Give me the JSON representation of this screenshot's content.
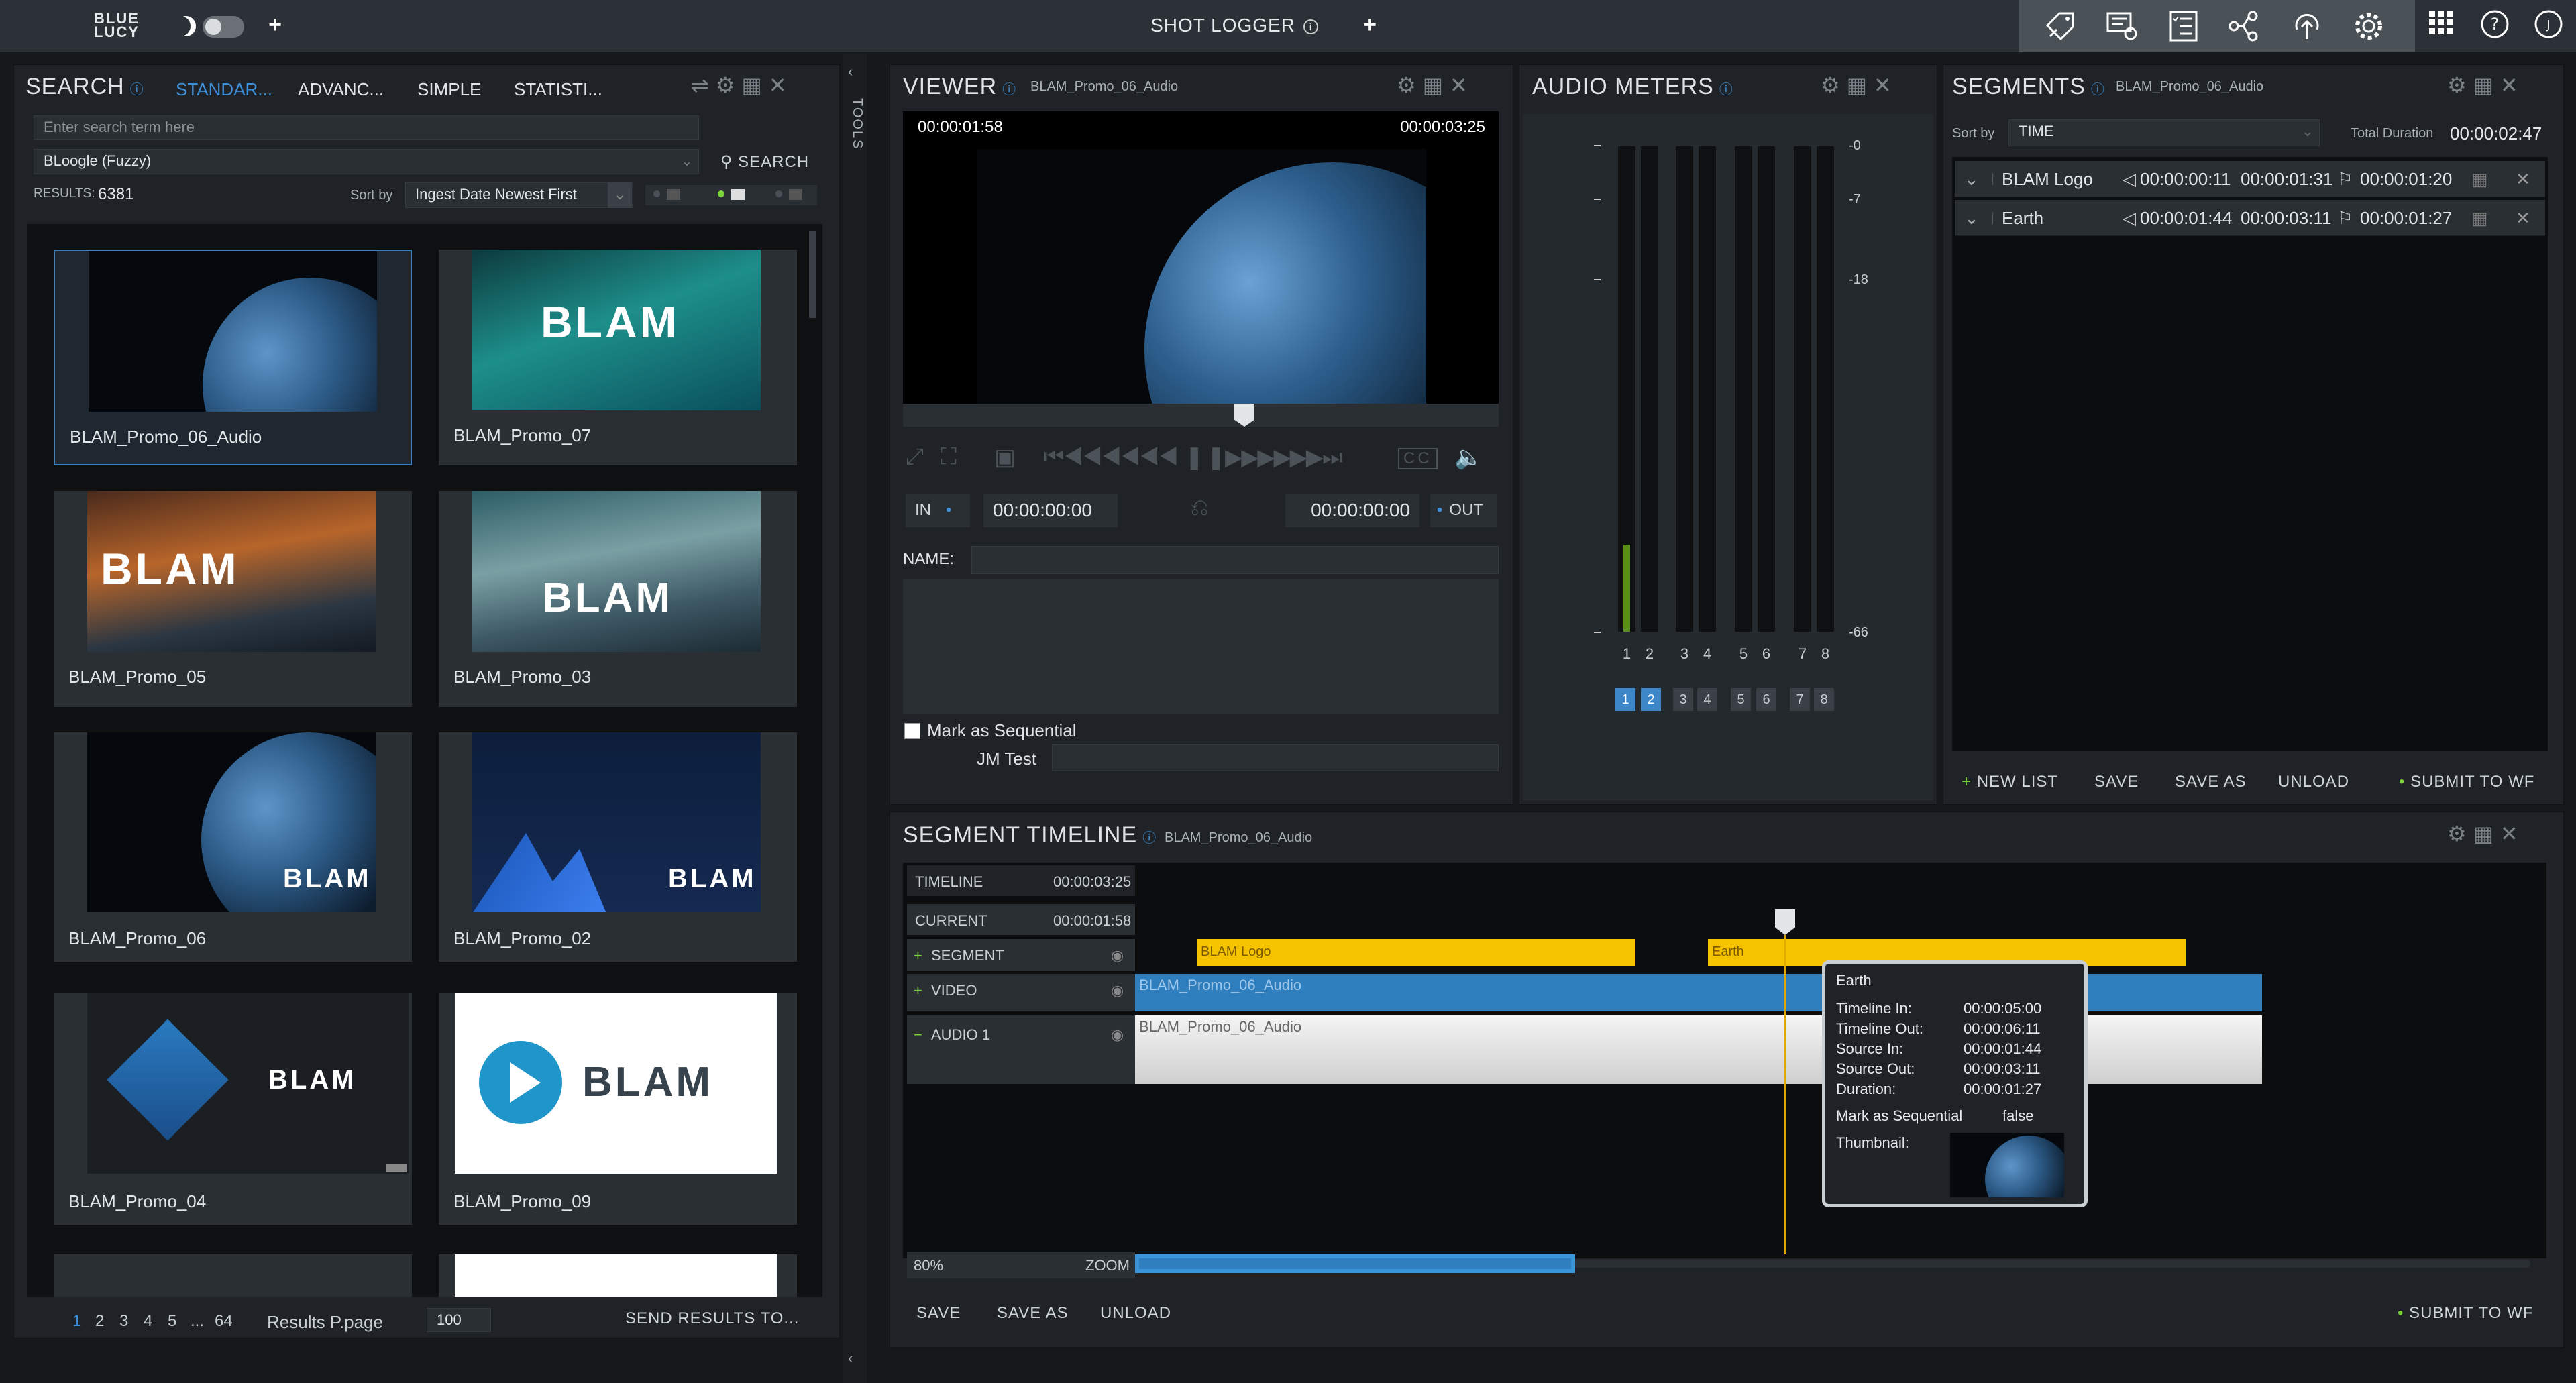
{
  "app": {
    "logo_line1": "BLUE",
    "logo_line2": "LUCY",
    "center_title": "SHOT LOGGER",
    "info_glyph": "i",
    "plus_glyph": "+"
  },
  "tools_icons": [
    "tag-edit-icon",
    "monitor-settings-icon",
    "checklist-icon",
    "workflow-icon",
    "upload-icon",
    "gear-icon",
    "grid-icon",
    "help-icon",
    "user-avatar-icon"
  ],
  "search": {
    "title": "SEARCH",
    "tabs": [
      "STANDAR...",
      "ADVANC...",
      "SIMPLE",
      "STATISTI..."
    ],
    "placeholder": "Enter search term here",
    "engine": "BLoogle (Fuzzy)",
    "search_button": "SEARCH",
    "results_label": "RESULTS:",
    "results_count": "6381",
    "sort_label": "Sort by",
    "sort_value": "Ingest Date Newest First",
    "items": [
      "BLAM_Promo_06_Audio",
      "BLAM_Promo_07",
      "BLAM_Promo_05",
      "BLAM_Promo_03",
      "BLAM_Promo_06",
      "BLAM_Promo_02",
      "BLAM_Promo_04",
      "BLAM_Promo_09"
    ],
    "blam_text": "BLAM",
    "pages": [
      "1",
      "2",
      "3",
      "4",
      "5",
      "...",
      "64"
    ],
    "results_per_page_label": "Results P.page",
    "results_per_page": "100",
    "send_results": "SEND RESULTS TO..."
  },
  "tools_tab": "TOOLS",
  "viewer": {
    "title": "VIEWER",
    "asset": "BLAM_Promo_06_Audio",
    "time_current": "00:00:01:58",
    "time_total": "00:00:03:25",
    "in_label": "IN",
    "out_label": "OUT",
    "in_time": "00:00:00:00",
    "out_time": "00:00:00:00",
    "name_label": "NAME:",
    "name_value": "",
    "mark_sequential": "Mark as Sequential",
    "jm_test": "JM Test",
    "cc_label": "CC"
  },
  "audio": {
    "title": "AUDIO METERS",
    "scale": [
      "-0",
      "-7",
      "-18",
      "-66"
    ],
    "channels": [
      "1",
      "2",
      "3",
      "4",
      "5",
      "6",
      "7",
      "8"
    ],
    "levels": [
      0.18,
      0,
      0,
      0,
      0,
      0,
      0,
      0
    ],
    "active_channels": [
      "1",
      "2"
    ]
  },
  "segments": {
    "title": "SEGMENTS",
    "asset": "BLAM_Promo_06_Audio",
    "sort_label": "Sort by",
    "sort_value": "TIME",
    "total_label": "Total Duration",
    "total_value": "00:00:02:47",
    "rows": [
      {
        "name": "BLAM Logo",
        "in": "00:00:00:11",
        "out": "00:00:01:31",
        "duration": "00:00:01:20"
      },
      {
        "name": "Earth",
        "in": "00:00:01:44",
        "out": "00:00:03:11",
        "duration": "00:00:01:27"
      }
    ],
    "buttons": {
      "new_list": "NEW LIST",
      "save": "SAVE",
      "save_as": "SAVE AS",
      "unload": "UNLOAD",
      "submit": "SUBMIT TO WF"
    }
  },
  "timeline": {
    "title": "SEGMENT TIMELINE",
    "asset": "BLAM_Promo_06_Audio",
    "timeline_label": "TIMELINE",
    "timeline_value": "00:00:03:25",
    "current_label": "CURRENT",
    "current_value": "00:00:01:58",
    "tracks": [
      "SEGMENT",
      "VIDEO",
      "AUDIO 1"
    ],
    "segment_blocks": [
      "BLAM Logo",
      "Earth"
    ],
    "clip_name": "BLAM_Promo_06_Audio",
    "zoom_value": "80%",
    "zoom_label": "ZOOM",
    "buttons": {
      "save": "SAVE",
      "save_as": "SAVE AS",
      "unload": "UNLOAD",
      "submit": "SUBMIT TO WF"
    },
    "tooltip": {
      "title": "Earth",
      "timeline_in_label": "Timeline In:",
      "timeline_in": "00:00:05:00",
      "timeline_out_label": "Timeline Out:",
      "timeline_out": "00:00:06:11",
      "source_in_label": "Source In:",
      "source_in": "00:00:01:44",
      "source_out_label": "Source Out:",
      "source_out": "00:00:03:11",
      "duration_label": "Duration:",
      "duration": "00:00:01:27",
      "mark_label": "Mark as Sequential",
      "mark_value": "false",
      "thumb_label": "Thumbnail:"
    }
  },
  "colors": {
    "accent": "#3d86c8",
    "segment": "#f5c300",
    "video": "#2f7fbf",
    "audio": "#e6e6e6"
  }
}
